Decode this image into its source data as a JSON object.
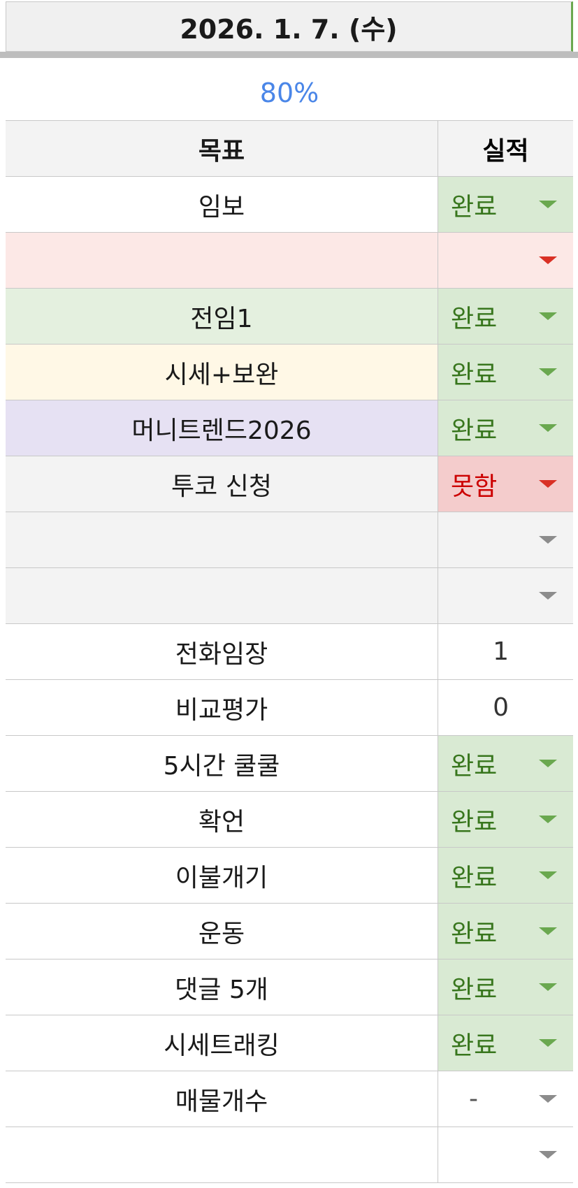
{
  "header": {
    "date": "2026. 1. 7. (수)"
  },
  "summary": {
    "percent": "80%"
  },
  "columns": {
    "goal": "목표",
    "result": "실적"
  },
  "rows": [
    {
      "goal": "임보",
      "result": "완료",
      "status": "done",
      "tint": "none"
    },
    {
      "goal": "",
      "result": "",
      "status": "empty-red",
      "tint": "pink"
    },
    {
      "goal": "전임1",
      "result": "완료",
      "status": "done",
      "tint": "green"
    },
    {
      "goal": "시세+보완",
      "result": "완료",
      "status": "done",
      "tint": "yellow"
    },
    {
      "goal": "머니트렌드2026",
      "result": "완료",
      "status": "done",
      "tint": "purple"
    },
    {
      "goal": "투코 신청",
      "result": "못함",
      "status": "fail",
      "tint": "gray"
    },
    {
      "goal": "",
      "result": "",
      "status": "empty-gray",
      "tint": "gray"
    },
    {
      "goal": "",
      "result": "",
      "status": "empty-gray",
      "tint": "gray"
    },
    {
      "goal": "전화임장",
      "result": "1",
      "status": "number",
      "tint": "none"
    },
    {
      "goal": "비교평가",
      "result": "0",
      "status": "number",
      "tint": "none"
    },
    {
      "goal": "5시간 쿨쿨",
      "result": "완료",
      "status": "done",
      "tint": "none"
    },
    {
      "goal": "확언",
      "result": "완료",
      "status": "done",
      "tint": "none"
    },
    {
      "goal": "이불개기",
      "result": "완료",
      "status": "done",
      "tint": "none"
    },
    {
      "goal": "운동",
      "result": "완료",
      "status": "done",
      "tint": "none"
    },
    {
      "goal": "댓글 5개",
      "result": "완료",
      "status": "done",
      "tint": "none"
    },
    {
      "goal": "시세트래킹",
      "result": "완료",
      "status": "done",
      "tint": "none"
    },
    {
      "goal": "매물개수",
      "result": "-",
      "status": "dash",
      "tint": "none"
    },
    {
      "goal": "",
      "result": "",
      "status": "empty-gray",
      "tint": "none"
    }
  ],
  "colors": {
    "done_bg": "#d9ead3",
    "done_text": "#38761d",
    "fail_bg": "#f4cccc",
    "fail_text": "#cc0000",
    "percent_text": "#4a86e8"
  },
  "icons": {
    "dropdown": "chevron-down-icon"
  }
}
